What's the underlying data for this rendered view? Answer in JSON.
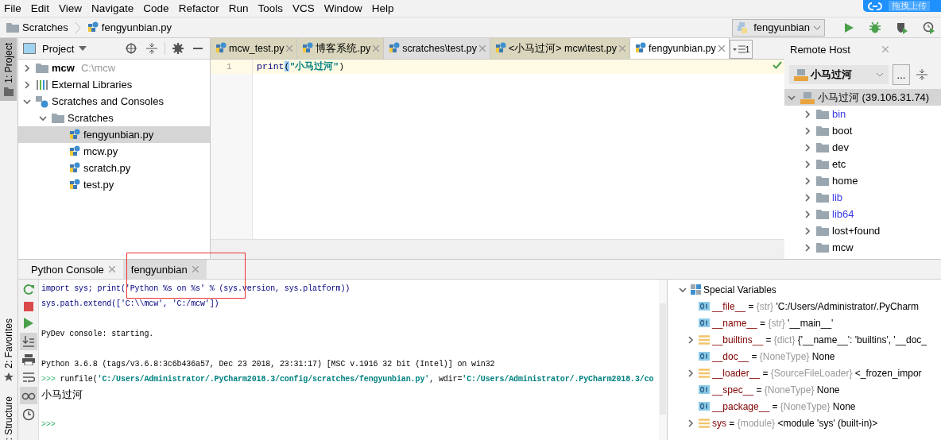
{
  "menu": [
    "File",
    "Edit",
    "View",
    "Navigate",
    "Code",
    "Refactor",
    "Run",
    "Tools",
    "VCS",
    "Window",
    "Help"
  ],
  "upload_button": "拖拽上传",
  "breadcrumb": [
    "Scratches",
    "fengyunbian.py"
  ],
  "run_config": "fengyunbian",
  "left_stripe": [
    {
      "label": "1: Project",
      "selected": true
    },
    {
      "label": "2: Favorites",
      "selected": false
    },
    {
      "label": ": Structure",
      "selected": false
    }
  ],
  "project_panel": {
    "title": "Project",
    "tree": [
      {
        "kind": "module",
        "name": "mcw",
        "path": "C:\\mcw",
        "expanded": false,
        "selected": false
      },
      {
        "kind": "library",
        "name": "External Libraries",
        "expanded": false,
        "selected": false
      },
      {
        "kind": "scratches",
        "name": "Scratches and Consoles",
        "expanded": true,
        "selected": false,
        "children": [
          {
            "kind": "folder",
            "name": "Scratches",
            "expanded": true,
            "selected": false,
            "children": [
              {
                "kind": "file",
                "name": "fengyunbian.py",
                "selected": true
              },
              {
                "kind": "file",
                "name": "mcw.py",
                "selected": false
              },
              {
                "kind": "file",
                "name": "scratch.py",
                "selected": false
              },
              {
                "kind": "file",
                "name": "test.py",
                "selected": false
              }
            ]
          }
        ]
      }
    ]
  },
  "editor_tabs": [
    {
      "label": "mcw_test.py",
      "kind": "project",
      "selected": false
    },
    {
      "label": "博客系统.py",
      "kind": "project",
      "selected": false
    },
    {
      "label": "scratches\\test.py",
      "kind": "scratch",
      "selected": false
    },
    {
      "label": "<小马过河> mcw\\test.py",
      "kind": "project",
      "selected": false
    },
    {
      "label": "fengyunbian.py",
      "kind": "scratch",
      "selected": true
    }
  ],
  "tab_overflow_count": "1",
  "editor": {
    "lines": [
      {
        "number": "1",
        "current": true,
        "tokens": [
          {
            "text": "print",
            "kind": "call"
          },
          {
            "text": "(",
            "kind": "brace"
          },
          {
            "text": "\"小马过河\"",
            "kind": "string"
          },
          {
            "text": ")",
            "kind": "plain"
          }
        ]
      }
    ]
  },
  "remote_host": {
    "title": "Remote Host",
    "server": "小马过河",
    "more_button": "...",
    "root": {
      "label": "小马过河 (39.106.31.74)",
      "expanded": true,
      "selected": true,
      "children": [
        {
          "name": "bin",
          "kind": "symlink"
        },
        {
          "name": "boot",
          "kind": "folder"
        },
        {
          "name": "dev",
          "kind": "folder"
        },
        {
          "name": "etc",
          "kind": "folder"
        },
        {
          "name": "home",
          "kind": "folder"
        },
        {
          "name": "lib",
          "kind": "symlink"
        },
        {
          "name": "lib64",
          "kind": "symlink"
        },
        {
          "name": "lost+found",
          "kind": "folder"
        },
        {
          "name": "mcw",
          "kind": "folder"
        }
      ]
    }
  },
  "bottom_tabs": [
    {
      "label": "Python Console",
      "selected": false
    },
    {
      "label": "fengyunbian",
      "selected": true
    }
  ],
  "console": {
    "blocks": [
      [
        {
          "tokens": [
            {
              "text": "import sys; print('Python %s on %s' % (sys.version, sys.platform))",
              "kind": "input"
            }
          ]
        },
        {
          "tokens": [
            {
              "text": "sys.path.extend(['C:\\\\mcw', 'C:/mcw'])",
              "kind": "input"
            }
          ]
        }
      ],
      [
        {
          "tokens": [
            {
              "text": "PyDev console: starting.",
              "kind": "output"
            }
          ]
        }
      ],
      [
        {
          "tokens": [
            {
              "text": "Python 3.6.8 (tags/v3.6.8:3c6b436a57, Dec 23 2018, 23:31:17) [MSC v.1916 32 bit (Intel)] on win32",
              "kind": "output"
            }
          ]
        },
        {
          "tokens": [
            {
              "text": ">>>",
              "kind": "prompt"
            },
            {
              "text": " runfile(",
              "kind": "output"
            },
            {
              "text": "'C:/Users/Administrator/.PyCharm2018.3/config/scratches/fengyunbian.py'",
              "kind": "string"
            },
            {
              "text": ", wdir=",
              "kind": "output"
            },
            {
              "text": "'C:/Users/Administrator/.PyCharm2018.3/co",
              "kind": "string"
            }
          ]
        },
        {
          "tokens": [
            {
              "text": "小马过河",
              "kind": "result"
            }
          ]
        }
      ],
      [
        {
          "tokens": [
            {
              "text": ">>>",
              "kind": "prompt"
            }
          ]
        }
      ]
    ]
  },
  "variables": {
    "group": "Special Variables",
    "expanded": true,
    "assign": "=",
    "items": [
      {
        "kind": "value",
        "name": "__file__",
        "type": "{str}",
        "value": "'C:/Users/Administrator/.PyCharm"
      },
      {
        "kind": "value",
        "name": "__name__",
        "type": "{str}",
        "value": "'__main__'"
      },
      {
        "kind": "collection",
        "name": "__builtins__",
        "type": "{dict}",
        "value": "{'__name__': 'builtins', '__doc_"
      },
      {
        "kind": "value",
        "name": "__doc__",
        "type": "{NoneType}",
        "value": "None"
      },
      {
        "kind": "collection",
        "name": "__loader__",
        "type": "{SourceFileLoader}",
        "value": "<_frozen_impor"
      },
      {
        "kind": "value",
        "name": "__spec__",
        "type": "{NoneType}",
        "value": "None"
      },
      {
        "kind": "value",
        "name": "__package__",
        "type": "{NoneType}",
        "value": "None"
      },
      {
        "kind": "collection",
        "name": "sys",
        "type": "{module}",
        "value": "<module 'sys' (built-in)>"
      }
    ]
  }
}
